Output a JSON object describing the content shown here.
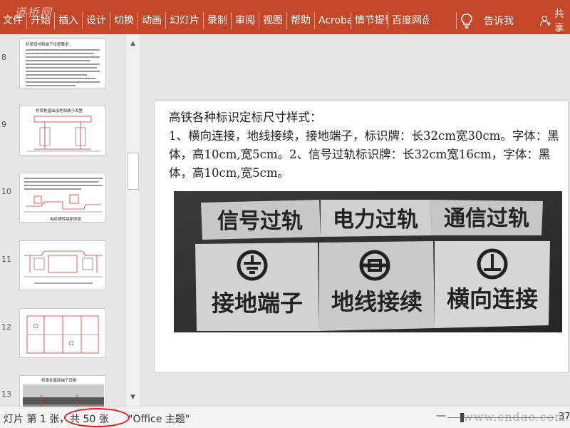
{
  "ribbon": {
    "tabs": [
      "文件",
      "开始",
      "插入",
      "设计",
      "切换",
      "动画",
      "幻灯片",
      "录制",
      "审阅",
      "视图",
      "帮助",
      "Acrobat",
      "情节提要",
      "百度网盘"
    ],
    "tell_me": "告诉我",
    "share": "共享",
    "watermark": "道桥网"
  },
  "slide": {
    "heading": "高铁各种标识定标尺寸样式：",
    "body": "1、横向连接，地线接续，接地端子，标识牌：长32cm宽30cm。字体：黑体，高10cm,宽5cm。2、信号过轨标识牌：长32cm宽16cm，字体：黑体，高10cm,宽5cm。",
    "photo_signs": {
      "top_row": [
        "信号过轨",
        "电力过轨",
        "通信过轨"
      ],
      "bottom_row": [
        "接地端子",
        "地线接续",
        "横向连接"
      ]
    }
  },
  "thumbnails": [
    {
      "number": "8"
    },
    {
      "number": "9"
    },
    {
      "number": "10"
    },
    {
      "number": "11"
    },
    {
      "number": "12"
    },
    {
      "number": "13"
    }
  ],
  "thumbnail_texts": {
    "t1_title": "桥梁接地和端子设置要求：",
    "t2_title": "桥梁桩基础接地和端子设置",
    "t3_caption": "电缆槽转接断面图",
    "t6_title": "桥梁桩基础端子设置"
  },
  "status": {
    "slide_prefix": "灯片 第 1 张，",
    "slide_count": "共 50 张",
    "theme": "\"Office 主题\"",
    "zoom_minus": "—",
    "zoom_value": "37",
    "watermark": "www.cndao.com"
  },
  "colors": {
    "ribbon": "#c4472a",
    "highlight_oval": "#e11d1d",
    "frame": "#a9d25b"
  }
}
